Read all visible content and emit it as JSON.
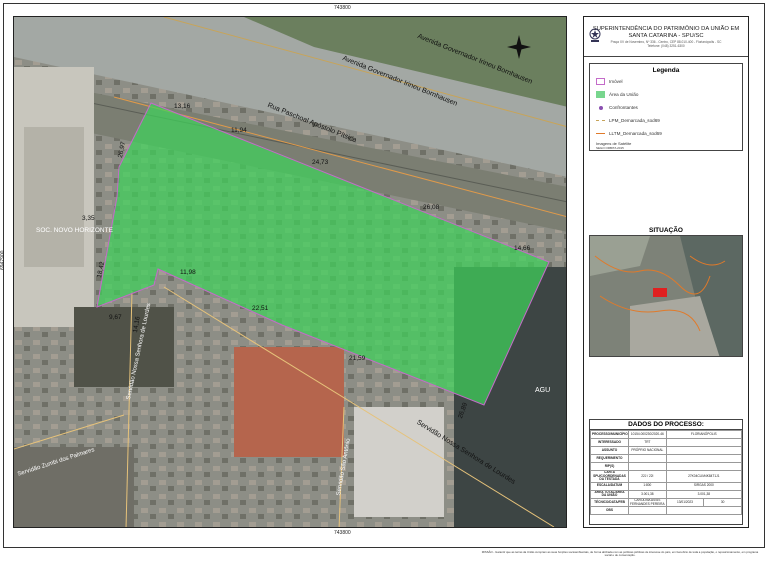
{
  "map": {
    "coord_top": "743800",
    "coord_bottom": "743800",
    "coord_left": "6947900",
    "coord_right": "6947900",
    "streets": {
      "av_governador_1": "Avenida Governador Irineu Bornhausen",
      "av_governador_2": "Avenida Governador Irineu Bornhausen",
      "rua_paschoal": "Rua Paschoal Apóstolo Pítsica",
      "servidao_lourdes_1": "Servidão Nossa Senhora de Lourdes",
      "servidao_lourdes_2": "Servidão Nossa Senhora de Lourdes",
      "servidao_zumbi": "Servidão Zumbi dos Palmares",
      "servidao_antonio": "Servidão São Antônio"
    },
    "places": {
      "soc": "SOC. NOVO HORIZONTE",
      "agu": "AGU"
    },
    "measurements": [
      "13,16",
      "11,94",
      "24,73",
      "26,08",
      "14,66",
      "26,97",
      "3,35",
      "18,42",
      "9,67",
      "14,16",
      "11,98",
      "22,51",
      "21,59",
      "26,89"
    ]
  },
  "header": {
    "title_line1": "SUPERINTENDÊNCIA DO PATRIMÔNIO DA UNIÃO EM",
    "title_line2": "SANTA CATARINA - SPU/SC",
    "address_line1": "Praça XV de Novembro, Nº 336 - Centro, CEP 88.010-400 - Florianópolis - SC",
    "address_line2": "Telefone: (048) 3251-6300"
  },
  "legend": {
    "title": "Legenda",
    "items": [
      "Imóvel",
      "Área da União",
      "Confrontantes",
      "LPM_Demarcada_sod69",
      "LLTM_Demarcada_sod69"
    ],
    "note1": "Imagens de Satélite",
    "note2": "SEGO ORBITA 2015"
  },
  "situacao": {
    "title": "SITUAÇÃO"
  },
  "process": {
    "title": "DADOS DO PROCESSO:",
    "rows": [
      {
        "k": "PROCESSO/MUNICÍPIO",
        "v1": "10154.000230/2020-46",
        "v2": "FLORIANÓPOLIS"
      },
      {
        "k": "INTERESSADO",
        "v1": "TRT",
        "v2": ""
      },
      {
        "k": "ASSUNTO",
        "v1": "PRÓPRIO NACIONAL",
        "v2": ""
      },
      {
        "k": "REQUERIMENTO",
        "v1": "",
        "v2": ""
      },
      {
        "k": "RIP(S)",
        "v1": "",
        "v2": ""
      },
      {
        "k": "CARTA SPU/COORDENADAS DA TESTADA",
        "v1": "22J / 22I",
        "v2": "27K04CLIM4K84T1J1"
      },
      {
        "k": "ESCALA/DATUM",
        "v1": "1:800",
        "v2": "SIRGAS 2000"
      },
      {
        "k": "ÁREA TOTAL/ÁREA DA UNIÃO",
        "v1": "3.001,38",
        "v2": "3.001,38"
      },
      {
        "k": "TÉCNICO/DATA/FEB",
        "v1": "CAROLINA ASSIS FERNANDES PEREIRA",
        "v2": "13/01/2023",
        "v3": "30"
      },
      {
        "k": "OBS",
        "v1": "",
        "v2": ""
      }
    ]
  },
  "footnote": "MISSÃO - Garantir que as terras da União cumpram as suas funções socioambientais, de forma alinhada com as políticas públicas de interesse do país, em benefício de toda a população, o reposicionamento, em programa social e de conservação."
}
